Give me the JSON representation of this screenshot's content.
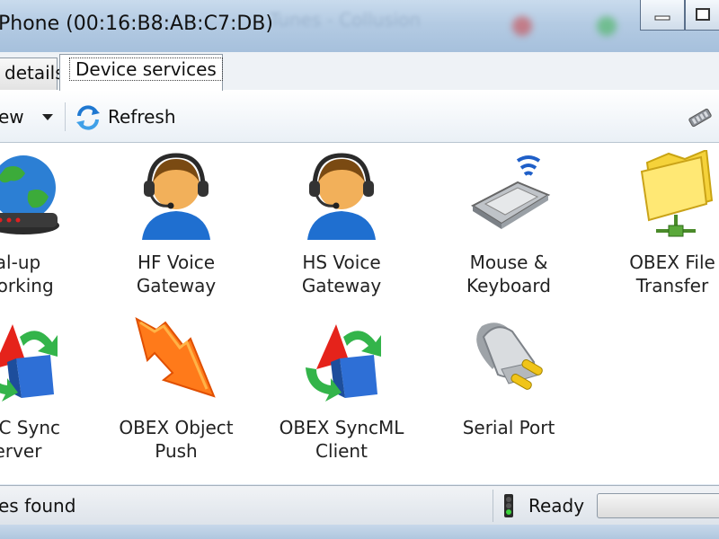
{
  "window": {
    "title": "Phone (00:16:B8:AB:C7:DB)",
    "background_text": "Tunes - Collusion"
  },
  "tabs": [
    {
      "label": "details",
      "active": false
    },
    {
      "label": "Device services",
      "active": true
    }
  ],
  "toolbar": {
    "view_label": "ew",
    "refresh_label": "Refresh"
  },
  "services": [
    {
      "line1": "al-up",
      "line2": "working",
      "icon": "globe-modem-icon"
    },
    {
      "line1": "HF Voice",
      "line2": "Gateway",
      "icon": "headset-user-icon"
    },
    {
      "line1": "HS Voice",
      "line2": "Gateway",
      "icon": "headset-user-icon"
    },
    {
      "line1": "Mouse &",
      "line2": "Keyboard",
      "icon": "wireless-keyboard-icon"
    },
    {
      "line1": "OBEX File",
      "line2": "Transfer",
      "icon": "network-folder-icon"
    },
    {
      "line1": "rMC Sync",
      "line2": "erver",
      "icon": "sync-arrows-icon"
    },
    {
      "line1": "OBEX Object",
      "line2": "Push",
      "icon": "push-arrow-icon"
    },
    {
      "line1": "OBEX SyncML",
      "line2": "Client",
      "icon": "sync-arrows-icon"
    },
    {
      "line1": "Serial Port",
      "line2": "",
      "icon": "serial-plug-icon"
    }
  ],
  "status": {
    "found_text": "es found",
    "ready_text": "Ready"
  },
  "colors": {
    "titlebar": "#b4cbe3",
    "accent_blue": "#1f78d1",
    "orange": "#ff7a1a",
    "green": "#37b34a"
  }
}
